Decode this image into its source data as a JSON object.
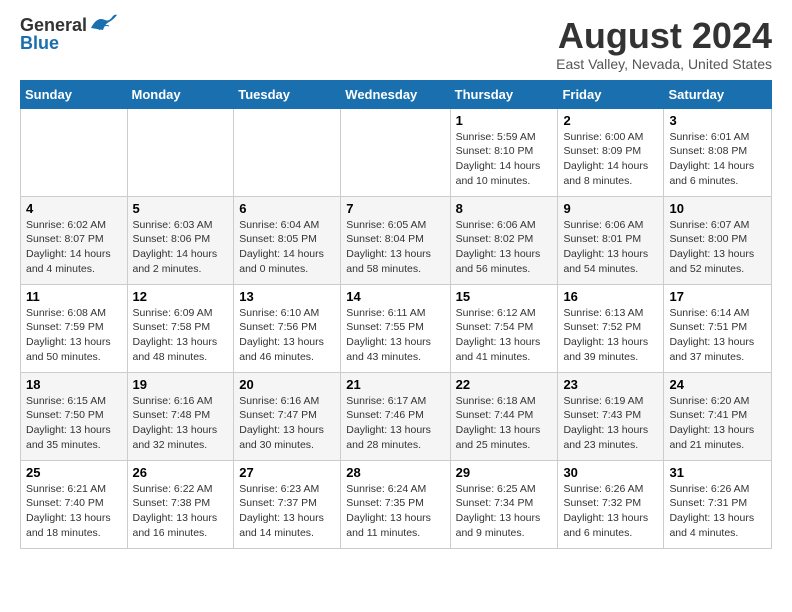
{
  "logo": {
    "general": "General",
    "blue": "Blue"
  },
  "header": {
    "title": "August 2024",
    "subtitle": "East Valley, Nevada, United States"
  },
  "weekdays": [
    "Sunday",
    "Monday",
    "Tuesday",
    "Wednesday",
    "Thursday",
    "Friday",
    "Saturday"
  ],
  "weeks": [
    [
      {
        "day": "",
        "info": ""
      },
      {
        "day": "",
        "info": ""
      },
      {
        "day": "",
        "info": ""
      },
      {
        "day": "",
        "info": ""
      },
      {
        "day": "1",
        "info": "Sunrise: 5:59 AM\nSunset: 8:10 PM\nDaylight: 14 hours and 10 minutes."
      },
      {
        "day": "2",
        "info": "Sunrise: 6:00 AM\nSunset: 8:09 PM\nDaylight: 14 hours and 8 minutes."
      },
      {
        "day": "3",
        "info": "Sunrise: 6:01 AM\nSunset: 8:08 PM\nDaylight: 14 hours and 6 minutes."
      }
    ],
    [
      {
        "day": "4",
        "info": "Sunrise: 6:02 AM\nSunset: 8:07 PM\nDaylight: 14 hours and 4 minutes."
      },
      {
        "day": "5",
        "info": "Sunrise: 6:03 AM\nSunset: 8:06 PM\nDaylight: 14 hours and 2 minutes."
      },
      {
        "day": "6",
        "info": "Sunrise: 6:04 AM\nSunset: 8:05 PM\nDaylight: 14 hours and 0 minutes."
      },
      {
        "day": "7",
        "info": "Sunrise: 6:05 AM\nSunset: 8:04 PM\nDaylight: 13 hours and 58 minutes."
      },
      {
        "day": "8",
        "info": "Sunrise: 6:06 AM\nSunset: 8:02 PM\nDaylight: 13 hours and 56 minutes."
      },
      {
        "day": "9",
        "info": "Sunrise: 6:06 AM\nSunset: 8:01 PM\nDaylight: 13 hours and 54 minutes."
      },
      {
        "day": "10",
        "info": "Sunrise: 6:07 AM\nSunset: 8:00 PM\nDaylight: 13 hours and 52 minutes."
      }
    ],
    [
      {
        "day": "11",
        "info": "Sunrise: 6:08 AM\nSunset: 7:59 PM\nDaylight: 13 hours and 50 minutes."
      },
      {
        "day": "12",
        "info": "Sunrise: 6:09 AM\nSunset: 7:58 PM\nDaylight: 13 hours and 48 minutes."
      },
      {
        "day": "13",
        "info": "Sunrise: 6:10 AM\nSunset: 7:56 PM\nDaylight: 13 hours and 46 minutes."
      },
      {
        "day": "14",
        "info": "Sunrise: 6:11 AM\nSunset: 7:55 PM\nDaylight: 13 hours and 43 minutes."
      },
      {
        "day": "15",
        "info": "Sunrise: 6:12 AM\nSunset: 7:54 PM\nDaylight: 13 hours and 41 minutes."
      },
      {
        "day": "16",
        "info": "Sunrise: 6:13 AM\nSunset: 7:52 PM\nDaylight: 13 hours and 39 minutes."
      },
      {
        "day": "17",
        "info": "Sunrise: 6:14 AM\nSunset: 7:51 PM\nDaylight: 13 hours and 37 minutes."
      }
    ],
    [
      {
        "day": "18",
        "info": "Sunrise: 6:15 AM\nSunset: 7:50 PM\nDaylight: 13 hours and 35 minutes."
      },
      {
        "day": "19",
        "info": "Sunrise: 6:16 AM\nSunset: 7:48 PM\nDaylight: 13 hours and 32 minutes."
      },
      {
        "day": "20",
        "info": "Sunrise: 6:16 AM\nSunset: 7:47 PM\nDaylight: 13 hours and 30 minutes."
      },
      {
        "day": "21",
        "info": "Sunrise: 6:17 AM\nSunset: 7:46 PM\nDaylight: 13 hours and 28 minutes."
      },
      {
        "day": "22",
        "info": "Sunrise: 6:18 AM\nSunset: 7:44 PM\nDaylight: 13 hours and 25 minutes."
      },
      {
        "day": "23",
        "info": "Sunrise: 6:19 AM\nSunset: 7:43 PM\nDaylight: 13 hours and 23 minutes."
      },
      {
        "day": "24",
        "info": "Sunrise: 6:20 AM\nSunset: 7:41 PM\nDaylight: 13 hours and 21 minutes."
      }
    ],
    [
      {
        "day": "25",
        "info": "Sunrise: 6:21 AM\nSunset: 7:40 PM\nDaylight: 13 hours and 18 minutes."
      },
      {
        "day": "26",
        "info": "Sunrise: 6:22 AM\nSunset: 7:38 PM\nDaylight: 13 hours and 16 minutes."
      },
      {
        "day": "27",
        "info": "Sunrise: 6:23 AM\nSunset: 7:37 PM\nDaylight: 13 hours and 14 minutes."
      },
      {
        "day": "28",
        "info": "Sunrise: 6:24 AM\nSunset: 7:35 PM\nDaylight: 13 hours and 11 minutes."
      },
      {
        "day": "29",
        "info": "Sunrise: 6:25 AM\nSunset: 7:34 PM\nDaylight: 13 hours and 9 minutes."
      },
      {
        "day": "30",
        "info": "Sunrise: 6:26 AM\nSunset: 7:32 PM\nDaylight: 13 hours and 6 minutes."
      },
      {
        "day": "31",
        "info": "Sunrise: 6:26 AM\nSunset: 7:31 PM\nDaylight: 13 hours and 4 minutes."
      }
    ]
  ]
}
